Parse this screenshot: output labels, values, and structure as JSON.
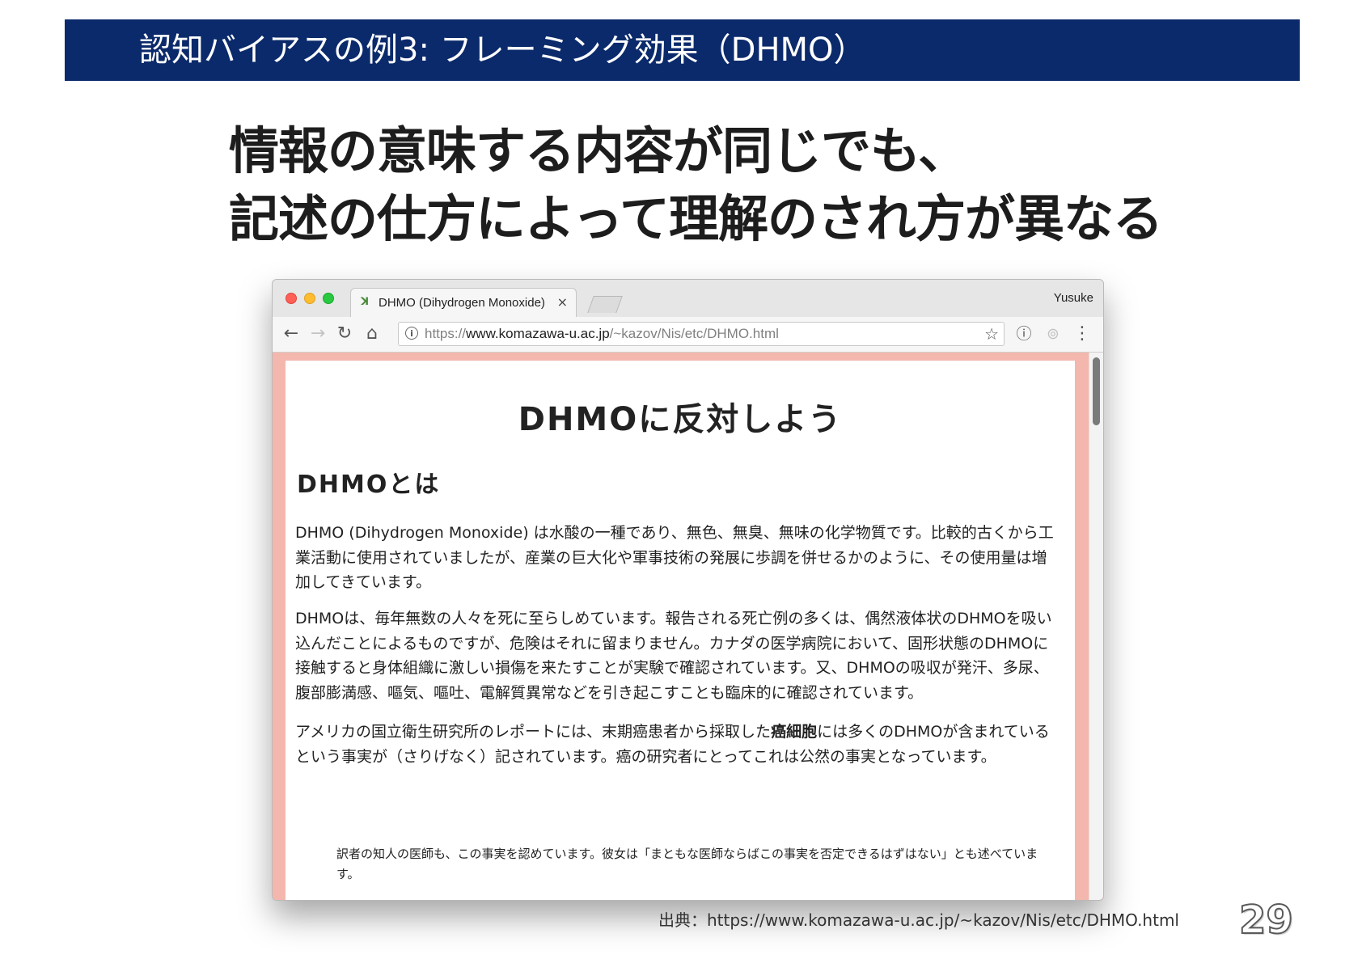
{
  "slide": {
    "title": "認知バイアスの例3: フレーミング効果（DHMO）",
    "heading_line1": "情報の意味する内容が同じでも、",
    "heading_line2": "記述の仕方によって理解のされ方が異なる",
    "source": "出典：https://www.komazawa-u.ac.jp/~kazov/Nis/etc/DHMO.html",
    "page_number": "29"
  },
  "browser": {
    "tab_title": "DHMO (Dihydrogen Monoxide)",
    "tab_close": "×",
    "profile_name": "Yusuke",
    "url_scheme": "https://",
    "url_host": "www.komazawa-u.ac.jp",
    "url_path": "/~kazov/Nis/etc/DHMO.html",
    "icons": {
      "back": "←",
      "forward": "→",
      "reload": "↻",
      "home": "⌂",
      "info": "i",
      "bookmark": "☆",
      "extension1": "ⓘ",
      "extension2": "⊚",
      "menu": "⋮"
    }
  },
  "webpage": {
    "h1": "DHMOに反対しよう",
    "h2": "DHMOとは",
    "p1": "DHMO (Dihydrogen Monoxide) は水酸の一種であり、無色、無臭、無味の化学物質です。比較的古くから工業活動に使用されていましたが、産業の巨大化や軍事技術の発展に歩調を併せるかのように、その使用量は増加してきています。",
    "p2": "DHMOは、毎年無数の人々を死に至らしめています。報告される死亡例の多くは、偶然液体状のDHMOを吸い込んだことによるものですが、危険はそれに留まりません。カナダの医学病院において、固形状態のDHMOに接触すると身体組織に激しい損傷を来たすことが実験で確認されています。又、DHMOの吸収が発汗、多尿、腹部膨満感、嘔気、嘔吐、電解質異常などを引き起こすことも臨床的に確認されています。",
    "p3_before": "アメリカの国立衛生研究所のレポートには、末期癌患者から採取した",
    "p3_bold": "癌細胞",
    "p3_after": "には多くのDHMOが含まれているという事実が（さりげなく）記されています。癌の研究者にとってこれは公然の事実となっています。",
    "quote": "訳者の知人の医師も、この事実を認めています。彼女は「まともな医師ならばこの事実を否定できるはずはない」とも述べています。"
  }
}
